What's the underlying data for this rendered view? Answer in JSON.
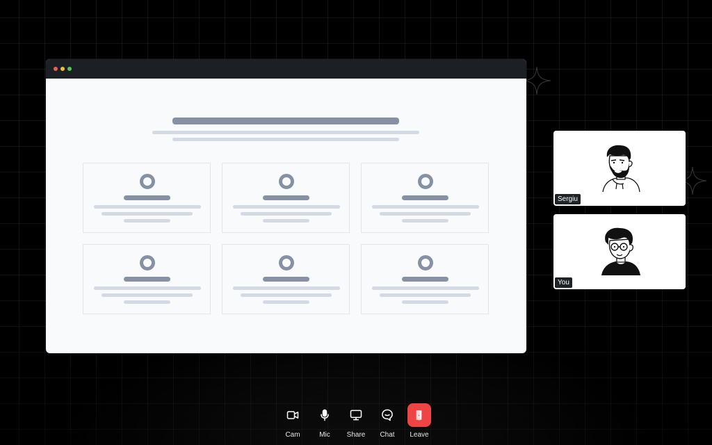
{
  "participants": [
    {
      "name": "Sergiu"
    },
    {
      "name": "You"
    }
  ],
  "controls": {
    "cam": "Cam",
    "mic": "Mic",
    "share": "Share",
    "chat": "Chat",
    "leave": "Leave"
  },
  "colors": {
    "leave": "#ef4444",
    "window_chrome": "#1c1f23",
    "skeleton_dark": "#8692a3",
    "skeleton_light": "#d3dae3"
  },
  "icons": [
    "camera-icon",
    "microphone-icon",
    "monitor-icon",
    "chat-bubble-icon",
    "door-exit-icon"
  ]
}
